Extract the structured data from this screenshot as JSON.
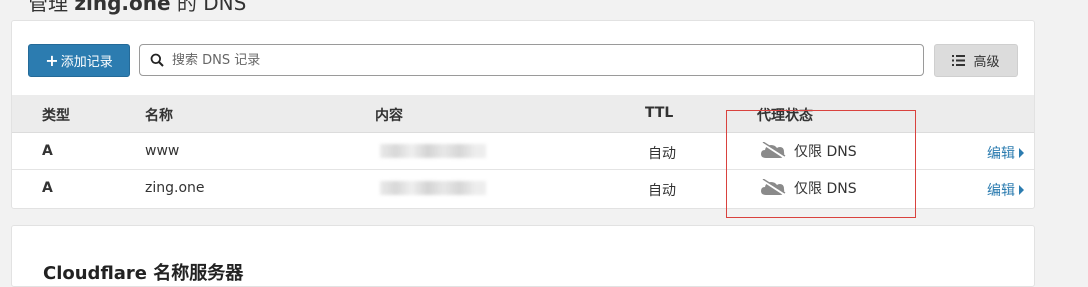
{
  "page": {
    "title_prefix": "管理",
    "domain": "zing.one",
    "title_suffix": "的 DNS"
  },
  "toolbar": {
    "add_label": "添加记录",
    "search_placeholder": "搜索 DNS 记录",
    "advanced_label": "高级"
  },
  "table": {
    "headers": [
      "类型",
      "名称",
      "内容",
      "TTL",
      "代理状态"
    ],
    "rows": [
      {
        "type": "A",
        "name": "www",
        "ttl": "自动",
        "proxy": "仅限 DNS",
        "edit": "编辑"
      },
      {
        "type": "A",
        "name": "zing.one",
        "ttl": "自动",
        "proxy": "仅限 DNS",
        "edit": "编辑"
      }
    ]
  },
  "nameservers": {
    "title": "Cloudflare 名称服务器"
  },
  "colors": {
    "accent": "#2c7cb0",
    "highlight": "#d9423e",
    "cloud": "#8a8a8a"
  }
}
